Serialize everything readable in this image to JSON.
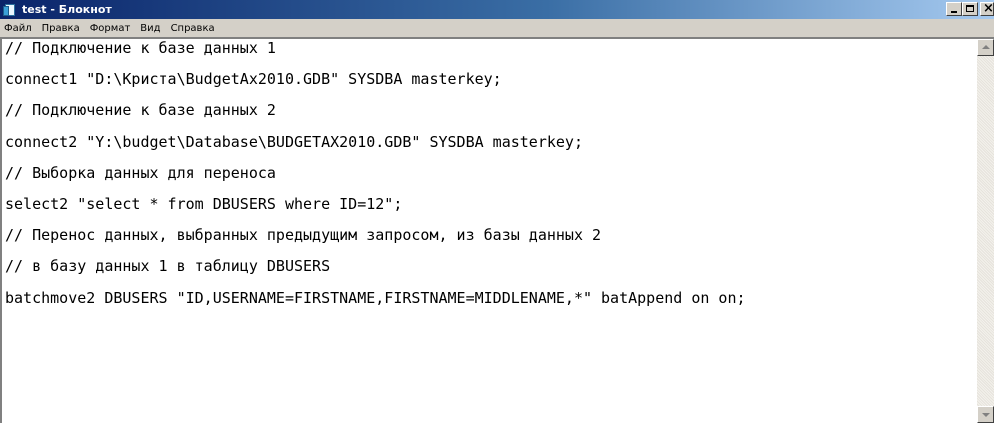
{
  "window": {
    "title": "test - Блокнот",
    "icon": "notepad-icon",
    "controls": [
      "minimize-icon",
      "maximize-icon",
      "close-icon"
    ],
    "close_glyph": "×"
  },
  "menu": {
    "items": [
      "Файл",
      "Правка",
      "Формат",
      "Вид",
      "Справка"
    ]
  },
  "editor": {
    "lines": [
      "// Подключение к базе данных 1",
      "connect1 \"D:\\Криста\\BudgetAx2010.GDB\" SYSDBA masterkey;",
      "// Подключение к базе данных 2",
      "connect2 \"Y:\\budget\\Database\\BUDGETAX2010.GDB\" SYSDBA masterkey;",
      "// Выборка данных для переноса",
      "select2 \"select * from DBUSERS where ID=12\";",
      "// Перенос данных, выбранных предыдущим запросом, из базы данных 2",
      "// в базу данных 1 в таблицу DBUSERS",
      "batchmove2 DBUSERS \"ID,USERNAME=FIRSTNAME,FIRSTNAME=MIDDLENAME,*\" batAppend on on;",
      ""
    ]
  },
  "colors": {
    "titlebar_start": "#0a246a",
    "titlebar_end": "#a6caf0",
    "chrome": "#d4d0c8"
  }
}
